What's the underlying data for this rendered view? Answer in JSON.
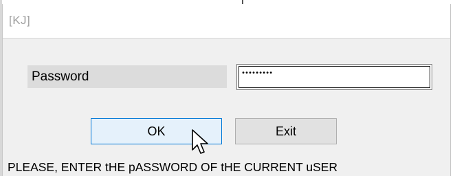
{
  "window": {
    "title": "[KJ]"
  },
  "form": {
    "password_label": "Password",
    "password_value": "•••••••••"
  },
  "buttons": {
    "ok_label": "OK",
    "exit_label": "Exit"
  },
  "status": {
    "message": "PLEASE, ENTER tHE pASSWORD OF tHE CURRENT uSER"
  },
  "icons": {
    "cursor": "mouse-pointer-icon"
  },
  "colors": {
    "ok_border": "#0078d7",
    "ok_background": "#e5f1fb",
    "label_background": "#dcdcdc"
  }
}
